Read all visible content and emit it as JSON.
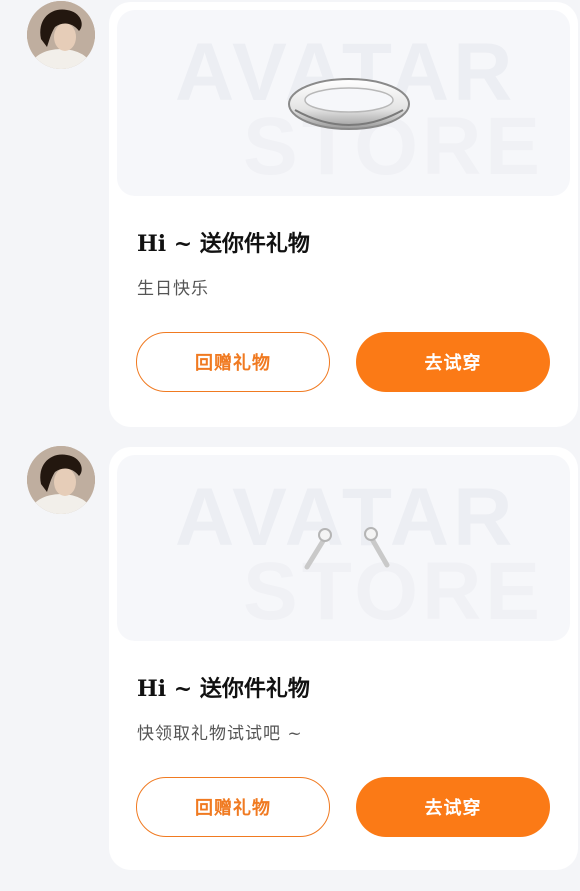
{
  "messages": [
    {
      "title": "Hi ~ 送你件礼物",
      "subtitle": "生日快乐",
      "watermark_top": "AVATAR",
      "watermark_bottom": "STORE",
      "item_icon": "halo-ring-icon",
      "return_gift_label": "回赠礼物",
      "try_on_label": "去试穿"
    },
    {
      "title": "Hi ~ 送你件礼物",
      "subtitle": "快领取礼物试试吧 ~",
      "watermark_top": "AVATAR",
      "watermark_bottom": "STORE",
      "item_icon": "earrings-icon",
      "return_gift_label": "回赠礼物",
      "try_on_label": "去试穿"
    }
  ],
  "colors": {
    "accent": "#fb7a16",
    "accent_outline": "#f07a21",
    "page_bg": "#f4f5f8",
    "card_bg": "#ffffff"
  }
}
